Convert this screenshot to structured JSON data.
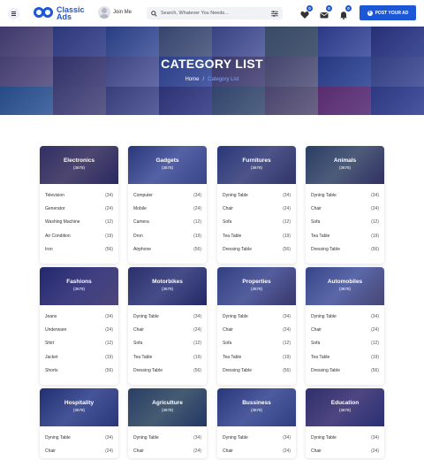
{
  "header": {
    "logo_line1": "Classic",
    "logo_line2": "Ads",
    "join_label": "Join Me",
    "search_placeholder": "Search, Whatever You Needs...",
    "badges": {
      "favorites": "0",
      "messages": "0",
      "notifications": "0"
    },
    "post_button": "POST YOUR AD"
  },
  "hero": {
    "title": "CATEGORY LIST",
    "breadcrumb": [
      "Home",
      "Category List"
    ]
  },
  "categories": [
    {
      "name": "Electronics",
      "count": "(3678)",
      "items": [
        [
          "Television",
          "(34)"
        ],
        [
          "Generator",
          "(24)"
        ],
        [
          "Washing Machine",
          "(12)"
        ],
        [
          "Air Condition",
          "(19)"
        ],
        [
          "Iron",
          "(56)"
        ]
      ]
    },
    {
      "name": "Gadgets",
      "count": "(3678)",
      "items": [
        [
          "Computer",
          "(34)"
        ],
        [
          "Mobile",
          "(24)"
        ],
        [
          "Camera",
          "(12)"
        ],
        [
          "Dron",
          "(19)"
        ],
        [
          "Airphone",
          "(56)"
        ]
      ]
    },
    {
      "name": "Furnitures",
      "count": "(3678)",
      "items": [
        [
          "Dyning Table",
          "(34)"
        ],
        [
          "Chair",
          "(24)"
        ],
        [
          "Sofa",
          "(12)"
        ],
        [
          "Tea Table",
          "(19)"
        ],
        [
          "Dressing Table",
          "(56)"
        ]
      ]
    },
    {
      "name": "Animals",
      "count": "(3678)",
      "items": [
        [
          "Dyning Table",
          "(34)"
        ],
        [
          "Chair",
          "(24)"
        ],
        [
          "Sofa",
          "(12)"
        ],
        [
          "Tea Table",
          "(19)"
        ],
        [
          "Dressing Table",
          "(56)"
        ]
      ]
    },
    {
      "name": "Fashions",
      "count": "(3678)",
      "items": [
        [
          "Jeans",
          "(34)"
        ],
        [
          "Underware",
          "(24)"
        ],
        [
          "Shirt",
          "(12)"
        ],
        [
          "Jacket",
          "(19)"
        ],
        [
          "Shorts",
          "(56)"
        ]
      ]
    },
    {
      "name": "Motorbikes",
      "count": "(3678)",
      "items": [
        [
          "Dyning Table",
          "(34)"
        ],
        [
          "Chair",
          "(24)"
        ],
        [
          "Sofa",
          "(12)"
        ],
        [
          "Tea Table",
          "(19)"
        ],
        [
          "Dressing Table",
          "(56)"
        ]
      ]
    },
    {
      "name": "Properties",
      "count": "(3678)",
      "items": [
        [
          "Dyning Table",
          "(34)"
        ],
        [
          "Chair",
          "(24)"
        ],
        [
          "Sofa",
          "(12)"
        ],
        [
          "Tea Table",
          "(19)"
        ],
        [
          "Dressing Table",
          "(56)"
        ]
      ]
    },
    {
      "name": "Automobiles",
      "count": "(3678)",
      "items": [
        [
          "Dyning Table",
          "(34)"
        ],
        [
          "Chair",
          "(24)"
        ],
        [
          "Sofa",
          "(12)"
        ],
        [
          "Tea Table",
          "(19)"
        ],
        [
          "Dressing Table",
          "(56)"
        ]
      ]
    },
    {
      "name": "Hospitality",
      "count": "(3678)",
      "items": [
        [
          "Dyning Table",
          "(34)"
        ],
        [
          "Chair",
          "(24)"
        ]
      ]
    },
    {
      "name": "Agriculture",
      "count": "(3678)",
      "items": [
        [
          "Dyning Table",
          "(34)"
        ],
        [
          "Chair",
          "(24)"
        ]
      ]
    },
    {
      "name": "Bussiness",
      "count": "(3678)",
      "items": [
        [
          "Dyning Table",
          "(34)"
        ],
        [
          "Chair",
          "(24)"
        ]
      ]
    },
    {
      "name": "Education",
      "count": "(3678)",
      "items": [
        [
          "Dyning Table",
          "(34)"
        ],
        [
          "Chair",
          "(24)"
        ]
      ]
    }
  ],
  "colors": {
    "brand": "#1c57d6",
    "hero_overlay": "#232d8c"
  }
}
